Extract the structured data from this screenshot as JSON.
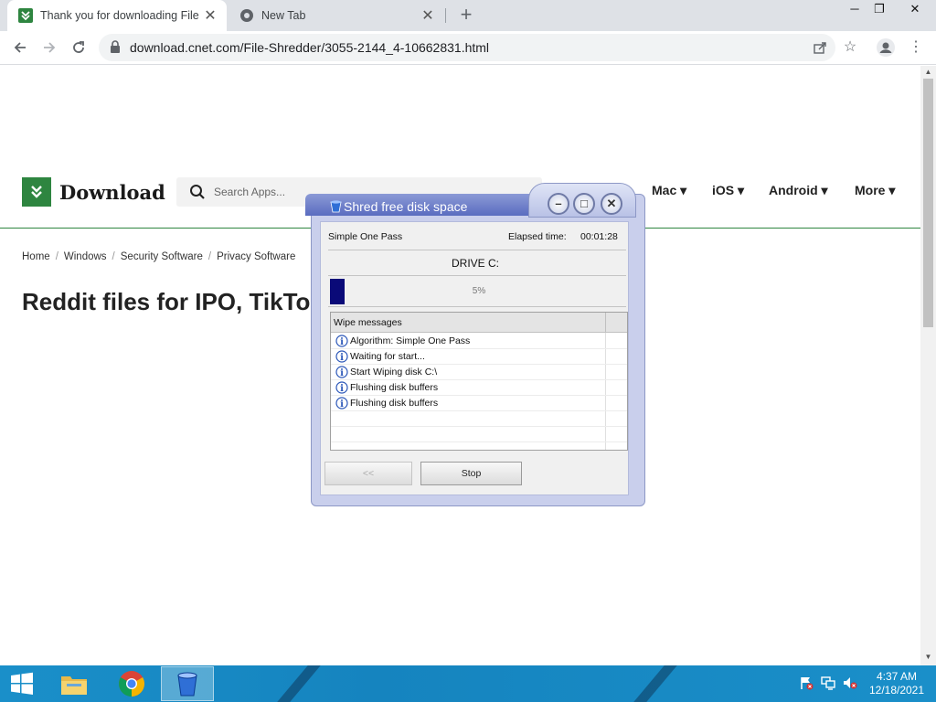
{
  "browser": {
    "tabs": [
      {
        "title": "Thank you for downloading File Shredder",
        "active": true,
        "close": "✕"
      },
      {
        "title": "New Tab",
        "active": false,
        "close": "✕"
      }
    ],
    "new_tab": "+",
    "window_controls": {
      "minimize": "─",
      "restore": "❐",
      "close": "✕"
    },
    "url": "download.cnet.com/File-Shredder/3055-2144_4-10662831.html"
  },
  "site": {
    "logo_text": "Download",
    "search_placeholder": "Search Apps...",
    "nav": [
      "Mac",
      "iOS",
      "Android",
      "More"
    ],
    "nav_caret": "▾",
    "breadcrumbs": [
      "Home",
      "Windows",
      "Security Software",
      "Privacy Software"
    ],
    "breadcrumb_sep": "/",
    "headline": "Reddit files for IPO, TikTok"
  },
  "dialog": {
    "title": "Shred free disk space",
    "algorithm": "Simple One Pass",
    "elapsed_label": "Elapsed time:",
    "elapsed_value": "00:01:28",
    "drive": "DRIVE C:",
    "progress_percent": 5,
    "progress_text": "5%",
    "list_header": "Wipe messages",
    "messages": [
      "Algorithm: Simple One Pass",
      "Waiting for start...",
      "Start Wiping disk C:\\",
      "Flushing disk buffers",
      "Flushing disk buffers"
    ],
    "back_button": "<<",
    "stop_button": "Stop",
    "controls": {
      "minimize": "–",
      "maximize": "□",
      "close": "✕"
    }
  },
  "taskbar": {
    "time": "4:37 AM",
    "date": "12/18/2021"
  },
  "colors": {
    "brand_green": "#2e8540",
    "taskbar_blue": "#1a8fc9",
    "progress_fill": "#0a0a78"
  }
}
